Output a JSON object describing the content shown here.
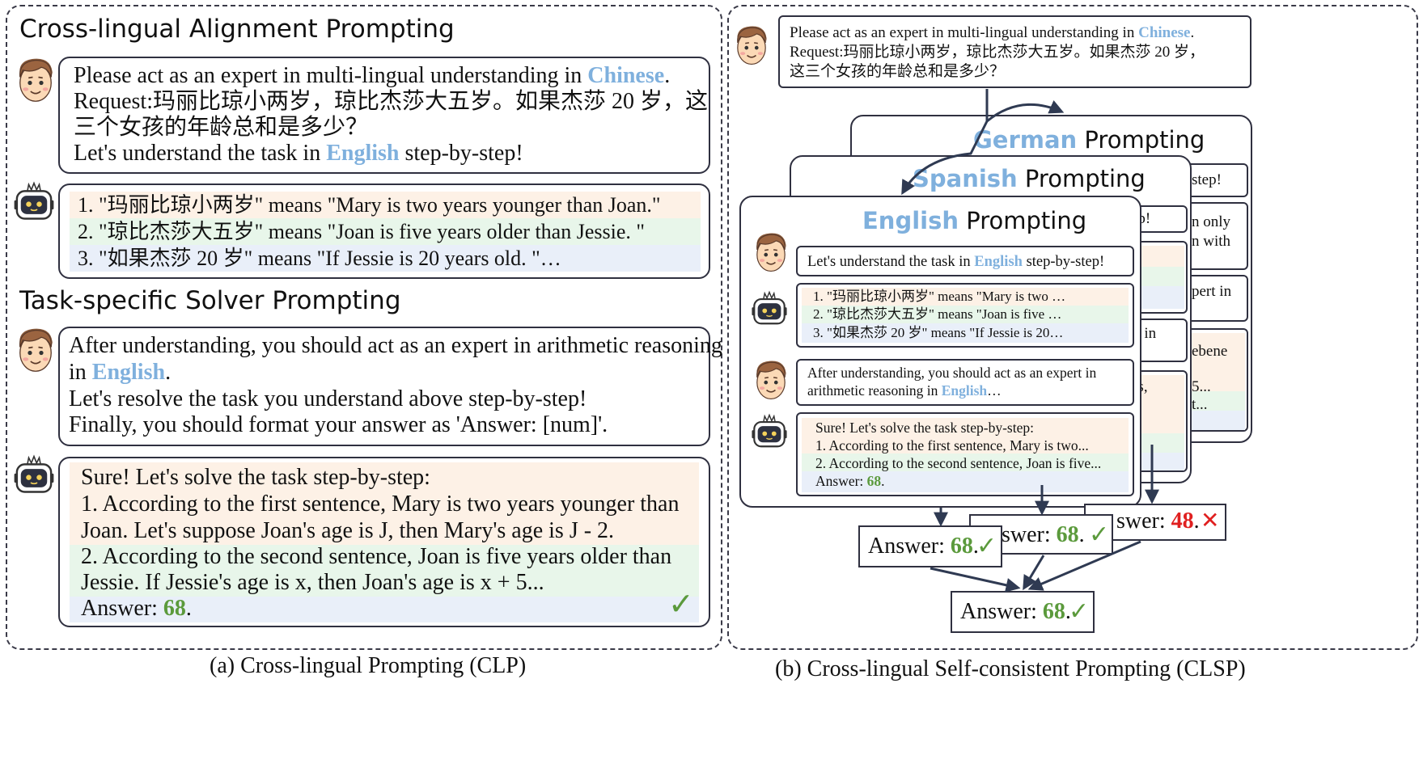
{
  "clp": {
    "heading1": "Cross-lingual Alignment Prompting",
    "req": {
      "line1_pre": "Please act as an expert in multi-lingual understanding in ",
      "line1_hl": "Chinese",
      "line1_post": ".",
      "line2": "Request:玛丽比琼小两岁，琼比杰莎大五岁。如果杰莎 20 岁，这",
      "line3": "三个女孩的年龄总和是多少？",
      "line4_pre": "Let's understand the task in ",
      "line4_hl": "English",
      "line4_post": " step-by-step!"
    },
    "align": {
      "r1": "1. \"玛丽比琼小两岁\" means \"Mary is two years younger than Joan.\"",
      "r2": "2. \"琼比杰莎大五岁\" means \"Joan is five years older than Jessie. \"",
      "r3": "3. \"如果杰莎 20 岁\" means \"If Jessie is 20 years old. \"…"
    },
    "heading2": "Task-specific Solver Prompting",
    "solver": {
      "line1": "After understanding, you should act as an expert in arithmetic reasoning",
      "line2_pre": "in ",
      "line2_hl": "English",
      "line2_post": ".",
      "line3": "Let's resolve the task you understand above step-by-step!",
      "line4": "Finally, you should format your answer as 'Answer: [num]'."
    },
    "solution": {
      "l1": "Sure! Let's solve the task step-by-step:",
      "l2": "1. According to the first sentence, Mary is two years younger than",
      "l3": "Joan. Let's suppose Joan's age is J, then Mary's age is J - 2.",
      "l4": "2. According to the second sentence, Joan is five years older than",
      "l5": "Jessie. If Jessie's age is x, then Joan's age is x + 5...",
      "ans_pre": "Answer: ",
      "ans_val": "68",
      "ans_post": ".",
      "check": "✓"
    },
    "caption": "(a) Cross-lingual Prompting (CLP)"
  },
  "clsp": {
    "req": {
      "line1_pre": "Please act as an expert in multi-lingual understanding in ",
      "line1_hl": "Chinese",
      "line1_post": ".",
      "line2": "Request:玛丽比琼小两岁，琼比杰莎大五岁。如果杰莎 20 岁，",
      "line3": "这三个女孩的年龄总和是多少？"
    },
    "german": {
      "title_hl": "German",
      "title_rest": " Prompting",
      "f1": "step!",
      "f2": "n only",
      "f3": "n with",
      "f4": "pert in",
      "f5": "ebene",
      "f6": "5...",
      "f7": "t..."
    },
    "spanish": {
      "title_hl": "Spanish",
      "title_rest": " Prompting",
      "f1": "ep!",
      "f2": "rt in",
      "f3": "as,"
    },
    "english": {
      "title_hl": "English",
      "title_rest": " Prompting",
      "u1_pre": "Let's understand the task in ",
      "u1_hl": "English",
      "u1_post": " step-by-step!",
      "a1": "1.   \"玛丽比琼小两岁\" means \"Mary is two …",
      "a2": "2.   \"琼比杰莎大五岁\" means \"Joan is five …",
      "a3": "3.   \"如果杰莎 20 岁\" means \"If Jessie is 20…",
      "s1": "After understanding, you should act as an expert in",
      "s2_pre": "arithmetic reasoning in ",
      "s2_hl": "English",
      "s2_post": "…",
      "r1": "Sure! Let's solve the task step-by-step:",
      "r2": "1. According to the first sentence, Mary is two...",
      "r3": "2. According to the second sentence, Joan is five...",
      "r4_pre": "Answer: ",
      "r4_val": "68",
      "r4_post": "."
    },
    "answers": {
      "a_en_pre": "Answer: ",
      "a_en_val": "68",
      "a_en_post": ".",
      "a_es_pre": "swer: ",
      "a_es_val": "68",
      "a_es_post": ".",
      "a_de_pre": "swer: ",
      "a_de_val": "48",
      "a_de_post": ".",
      "final_pre": "Answer: ",
      "final_val": "68",
      "final_post": ".",
      "check": "✓",
      "cross": "✕"
    },
    "caption": "(b) Cross-lingual Self-consistent Prompting (CLSP)"
  },
  "colors": {
    "highlight": "#7fb0dd",
    "correct": "#5b9a3c",
    "wrong": "#e02020",
    "row_orange": "#fdf1e6",
    "row_green": "#e8f6ea",
    "row_blue": "#e9eff9"
  },
  "icons": {
    "user": "user-avatar-icon",
    "robot": "robot-avatar-icon",
    "check": "check-icon",
    "cross": "cross-icon"
  }
}
